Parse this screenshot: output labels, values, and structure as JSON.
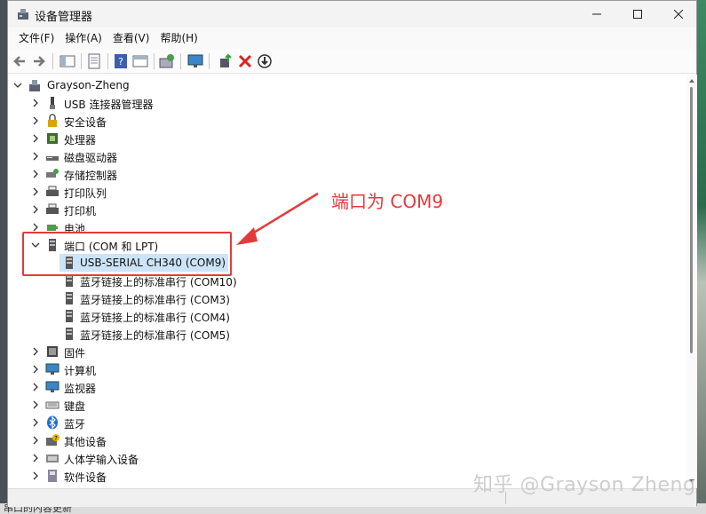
{
  "window": {
    "title": "设备管理器"
  },
  "menu": [
    "文件(F)",
    "操作(A)",
    "查看(V)",
    "帮助(H)"
  ],
  "tree": {
    "root": "Grayson-Zheng",
    "categories": [
      {
        "label": "USB 连接器管理器",
        "icon": "usb-connector-icon"
      },
      {
        "label": "安全设备",
        "icon": "security-device-icon"
      },
      {
        "label": "处理器",
        "icon": "processor-icon"
      },
      {
        "label": "磁盘驱动器",
        "icon": "disk-drive-icon"
      },
      {
        "label": "存储控制器",
        "icon": "storage-controller-icon"
      },
      {
        "label": "打印队列",
        "icon": "print-queue-icon"
      },
      {
        "label": "打印机",
        "icon": "printer-icon"
      },
      {
        "label": "电池",
        "icon": "battery-icon"
      },
      {
        "label": "端口 (COM 和 LPT)",
        "icon": "port-icon",
        "expanded": true,
        "children": [
          "USB-SERIAL CH340 (COM9)",
          "蓝牙链接上的标准串行 (COM10)",
          "蓝牙链接上的标准串行 (COM3)",
          "蓝牙链接上的标准串行 (COM4)",
          "蓝牙链接上的标准串行 (COM5)"
        ]
      },
      {
        "label": "固件",
        "icon": "firmware-icon"
      },
      {
        "label": "计算机",
        "icon": "computer-icon"
      },
      {
        "label": "监视器",
        "icon": "monitor-icon"
      },
      {
        "label": "键盘",
        "icon": "keyboard-icon"
      },
      {
        "label": "蓝牙",
        "icon": "bluetooth-icon"
      },
      {
        "label": "其他设备",
        "icon": "other-device-icon"
      },
      {
        "label": "人体学输入设备",
        "icon": "hid-icon"
      },
      {
        "label": "软件设备",
        "icon": "software-device-icon"
      }
    ]
  },
  "annotation": "端口为 COM9",
  "watermark": "知乎 @Grayson Zheng",
  "desktop_bottom_text": "串口的内容更新",
  "colors": {
    "annotation_red": "#e23b3b",
    "selection": "#cce4f7"
  }
}
